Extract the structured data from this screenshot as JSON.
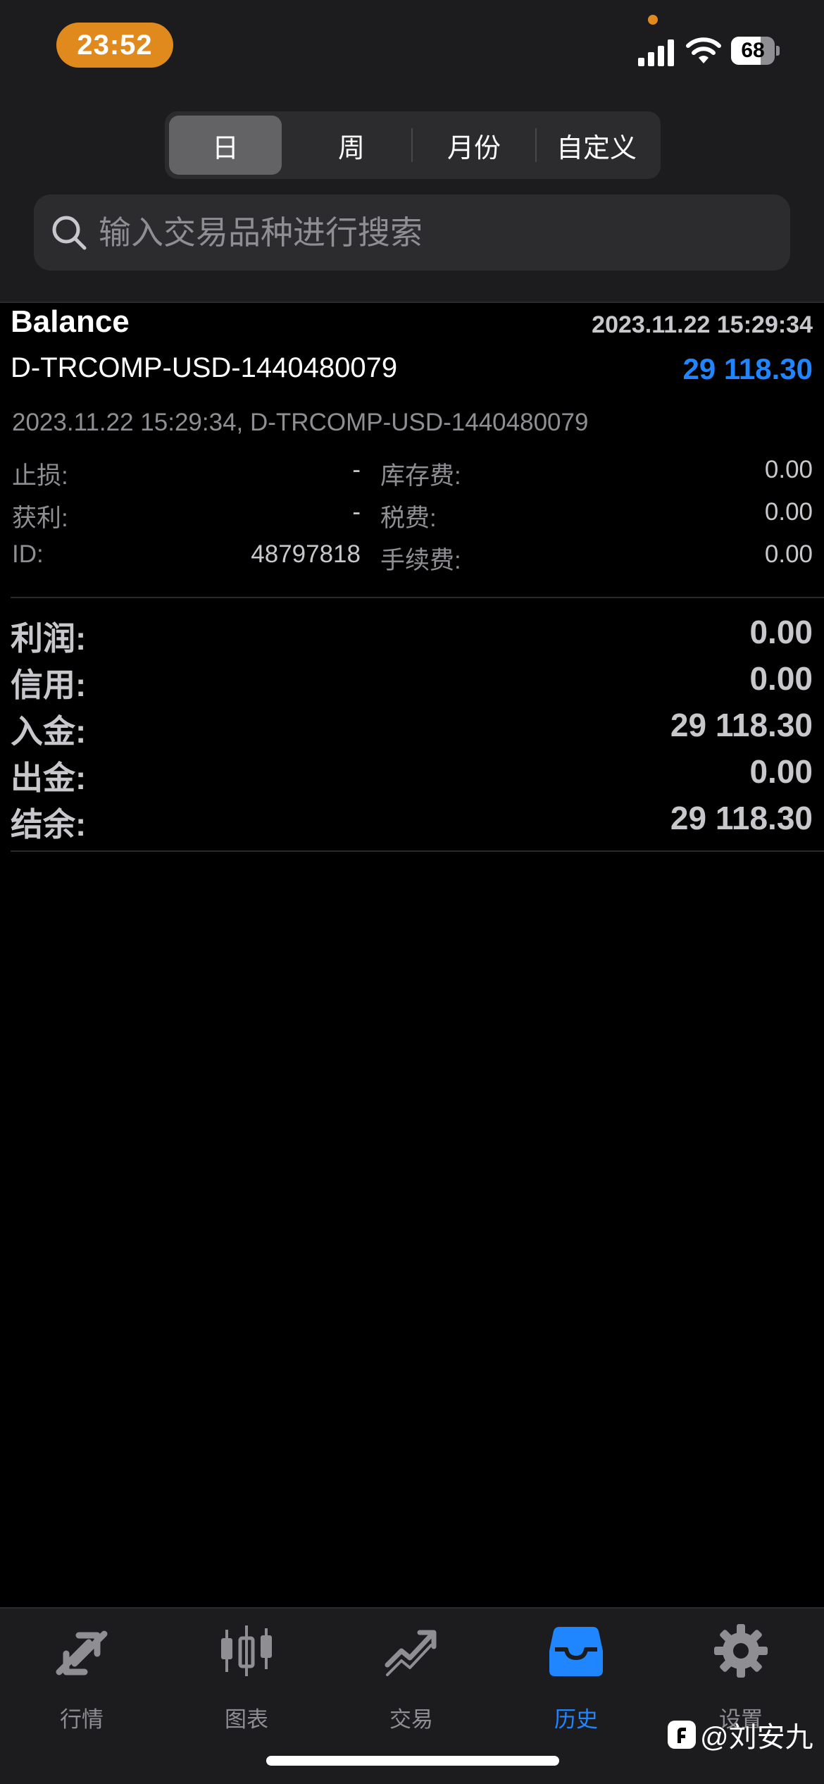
{
  "status_bar": {
    "time": "23:52",
    "battery": "68",
    "battery_level": 0.68
  },
  "period_tabs": [
    {
      "label": "日",
      "active": true
    },
    {
      "label": "周",
      "active": false
    },
    {
      "label": "月份",
      "active": false
    },
    {
      "label": "自定义",
      "active": false
    }
  ],
  "search": {
    "placeholder": "输入交易品种进行搜索",
    "value": ""
  },
  "record": {
    "type": "Balance",
    "time": "2023.11.22 15:29:34",
    "symbol": "D-TRCOMP-USD-1440480079",
    "amount": "29 118.30",
    "comment": "2023.11.22 15:29:34, D-TRCOMP-USD-1440480079",
    "fields_left": [
      {
        "label": "止损:",
        "value": "-"
      },
      {
        "label": "获利:",
        "value": "-"
      },
      {
        "label": "ID:",
        "value": "48797818"
      }
    ],
    "fields_right": [
      {
        "label": "库存费:",
        "value": "0.00"
      },
      {
        "label": "税费:",
        "value": "0.00"
      },
      {
        "label": "手续费:",
        "value": "0.00"
      }
    ]
  },
  "summary": [
    {
      "label": "利润:",
      "value": "0.00"
    },
    {
      "label": "信用:",
      "value": "0.00"
    },
    {
      "label": "入金:",
      "value": "29 118.30"
    },
    {
      "label": "出金:",
      "value": "0.00"
    },
    {
      "label": "结余:",
      "value": "29 118.30"
    }
  ],
  "tab_bar": [
    {
      "label": "行情",
      "icon": "quotes-arrows-icon",
      "active": false
    },
    {
      "label": "图表",
      "icon": "candlestick-chart-icon",
      "active": false
    },
    {
      "label": "交易",
      "icon": "trade-trend-icon",
      "active": false
    },
    {
      "label": "历史",
      "icon": "history-inbox-icon",
      "active": true
    },
    {
      "label": "设置",
      "icon": "gear-icon",
      "active": false
    }
  ],
  "watermark": {
    "text": "@刘安九"
  },
  "colors": {
    "accent": "#1f86ff",
    "time_pill": "#e08a1e",
    "background": "#000000",
    "header_bg": "#1c1c1e"
  }
}
